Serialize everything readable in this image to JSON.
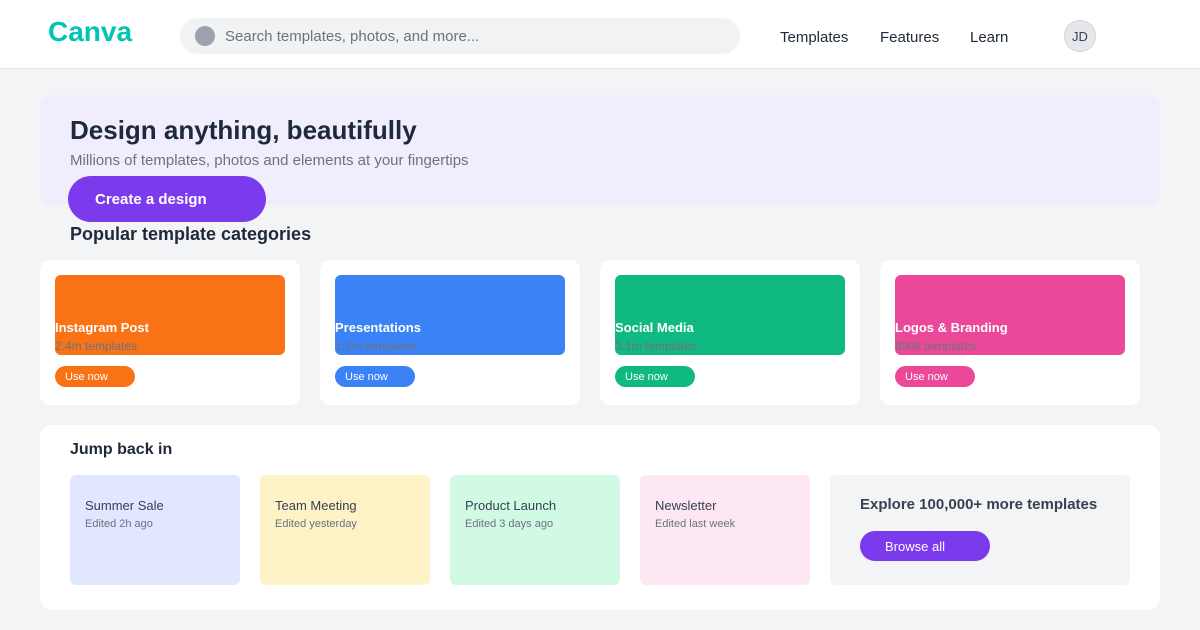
{
  "header": {
    "logo": "Canva",
    "search_placeholder": "Search templates, photos, and more...",
    "search_icon": "search-icon",
    "nav": [
      {
        "label": "Templates"
      },
      {
        "label": "Features"
      },
      {
        "label": "Learn"
      }
    ],
    "avatar_initials": "JD"
  },
  "hero": {
    "title": "Design anything, beautifully",
    "subtitle": "Millions of templates, photos and elements at your fingertips",
    "cta_label": "Create a design",
    "cta_color": "#7c3aed",
    "background_color": "#f0eefc"
  },
  "categories": {
    "title": "Popular template categories",
    "items": [
      {
        "name": "Instagram Post",
        "count": "2.4m templates",
        "button_label": "Use now",
        "color": "#f97316"
      },
      {
        "name": "Presentations",
        "count": "1.2m templates",
        "button_label": "Use now",
        "color": "#3b82f6"
      },
      {
        "name": "Social Media",
        "count": "3.1m templates",
        "button_label": "Use now",
        "color": "#10b981"
      },
      {
        "name": "Logos & Branding",
        "count": "890k templates",
        "button_label": "Use now",
        "color": "#ec4899"
      }
    ]
  },
  "recent": {
    "title": "Jump back in",
    "items": [
      {
        "name": "Summer Sale",
        "edited": "Edited 2h ago",
        "color": "#e0e7ff"
      },
      {
        "name": "Team Meeting",
        "edited": "Edited yesterday",
        "color": "#fef3c7"
      },
      {
        "name": "Product Launch",
        "edited": "Edited 3 days ago",
        "color": "#d1fae5"
      },
      {
        "name": "Newsletter",
        "edited": "Edited last week",
        "color": "#fce7f3"
      }
    ],
    "explore_text": "Explore 100,000+ more templates",
    "browse_label": "Browse all"
  },
  "colors": {
    "brand": "#00c4b4",
    "accent": "#7c3aed",
    "background": "#f3f4f6"
  }
}
